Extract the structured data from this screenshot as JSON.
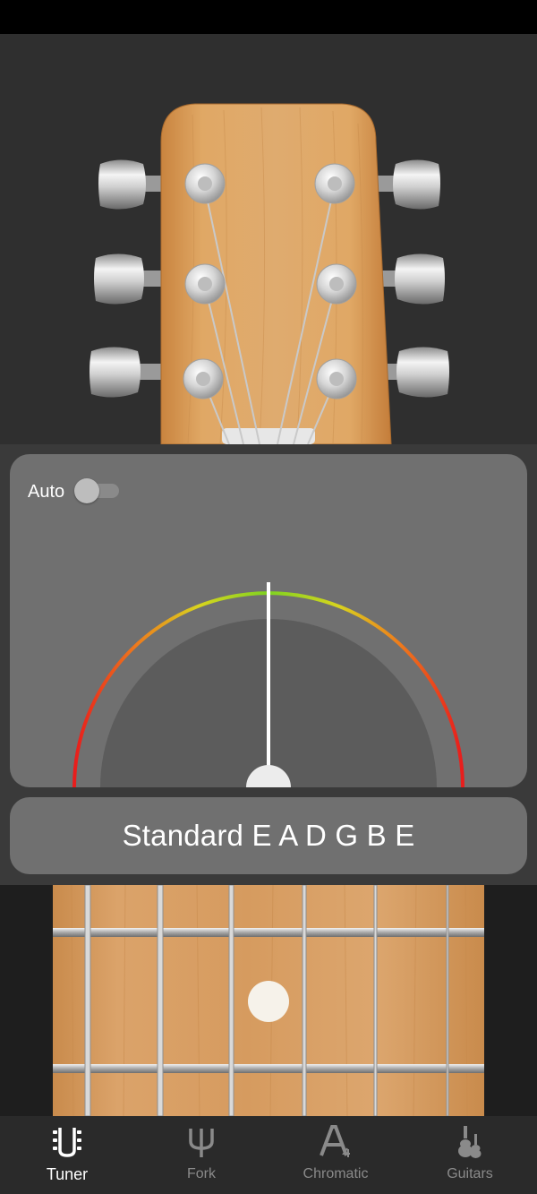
{
  "tuner": {
    "auto_label": "Auto",
    "auto_enabled": false,
    "tuning_name": "Standard E A D G B E",
    "needle_deviation_cents": 0
  },
  "nav": {
    "active": "tuner",
    "items": [
      {
        "id": "tuner",
        "label": "Tuner",
        "icon": "tuner-icon"
      },
      {
        "id": "fork",
        "label": "Fork",
        "icon": "tuning-fork-icon"
      },
      {
        "id": "chromatic",
        "label": "Chromatic",
        "icon": "chromatic-a4-icon"
      },
      {
        "id": "guitars",
        "label": "Guitars",
        "icon": "guitars-icon"
      }
    ]
  },
  "colors": {
    "panel": "#707070",
    "wood": "#d39a5c",
    "meter_in_tune": "#7ed321",
    "meter_flat_sharp": "#e81c1c",
    "active_tab": "#ffffff",
    "inactive_tab": "#8a8a8a"
  }
}
